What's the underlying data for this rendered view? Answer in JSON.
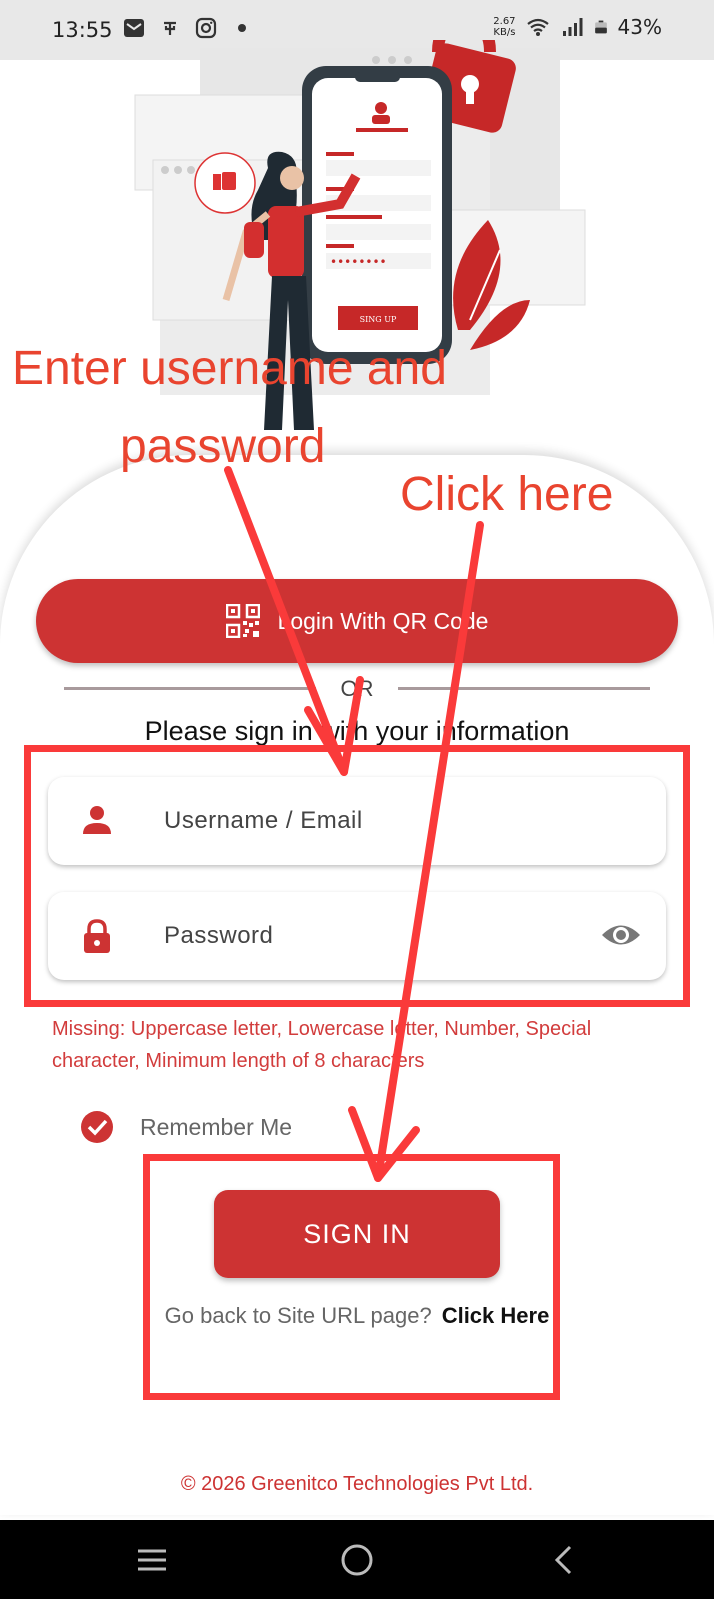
{
  "status_bar": {
    "time": "13:55",
    "net_speed_value": "2.67",
    "net_speed_unit": "KB/s",
    "battery": "43%"
  },
  "illustration": {
    "form_button_label": "SING UP"
  },
  "login": {
    "qr_button_label": "Login With QR Code",
    "or_label": "OR",
    "heading": "Please sign in with your information",
    "username_placeholder": "Username / Email",
    "password_placeholder": "Password",
    "error_message": "Missing: Uppercase letter, Lowercase letter, Number, Special character, Minimum length of 8 characters",
    "remember_label": "Remember Me",
    "remember_checked": true,
    "signin_label": "SIGN IN",
    "back_text": "Go back to Site URL page?",
    "back_link": "Click Here"
  },
  "footer": {
    "copyright": "© 2026 Greenitco Technologies Pvt Ltd."
  },
  "annotations": {
    "enter_credentials_line1": "Enter username and",
    "enter_credentials_line2": "password",
    "click_here": "Click here"
  },
  "colors": {
    "brand_red": "#cd3333",
    "annotation_red": "#fa3a3a",
    "error_red": "#d23c3c"
  },
  "icons": [
    "mail-icon",
    "usb-icon",
    "instagram-icon",
    "wifi-icon",
    "signal-icon",
    "battery-icon",
    "qr-code-icon",
    "user-icon",
    "lock-icon",
    "eye-icon",
    "check-circle-icon",
    "menu-icon",
    "home-icon",
    "back-icon"
  ]
}
